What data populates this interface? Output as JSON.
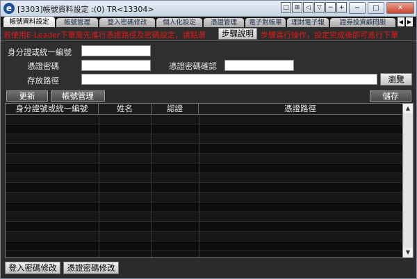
{
  "window": {
    "title": "[3303]帳號資料設定 :(0) TR<13304>",
    "small_buttons": [
      "□",
      "⊞",
      "◁",
      "▽",
      "−",
      "+"
    ],
    "minimize": "−",
    "maximize": "□",
    "close": "✕"
  },
  "tabs": [
    "帳號資料設定",
    "帳號管理",
    "登入密碼修改",
    "個人化設定",
    "憑證管理",
    "電子對帳單",
    "理財電子報",
    "證券投資顧問服"
  ],
  "tab_scroll": {
    "left": "◀",
    "right": "▶"
  },
  "notice": {
    "part1": "若使用E-Leader下單需先進行憑證路徑及密碼設定，請點選",
    "steps_button": "步驟說明",
    "part2": "步驟進行操作，設定完成後即可進行下單"
  },
  "form": {
    "id_label": "身分證或統一編號",
    "id_value": "",
    "cert_pw_label": "憑證密碼",
    "cert_pw_value": "",
    "cert_pw_confirm_label": "憑證密碼確認",
    "cert_pw_confirm_value": "",
    "path_label": "存放路徑",
    "path_value": "",
    "browse_button": "瀏覽"
  },
  "toolbar": {
    "refresh": "更新",
    "account_manage": "帳號管理",
    "save": "儲存"
  },
  "table": {
    "columns": [
      "身分證號或統一編號",
      "姓名",
      "認證",
      "憑證路徑"
    ],
    "rows": []
  },
  "bottom": {
    "login_pw_change": "登入密碼修改",
    "cert_pw_change": "憑證密碼修改"
  }
}
